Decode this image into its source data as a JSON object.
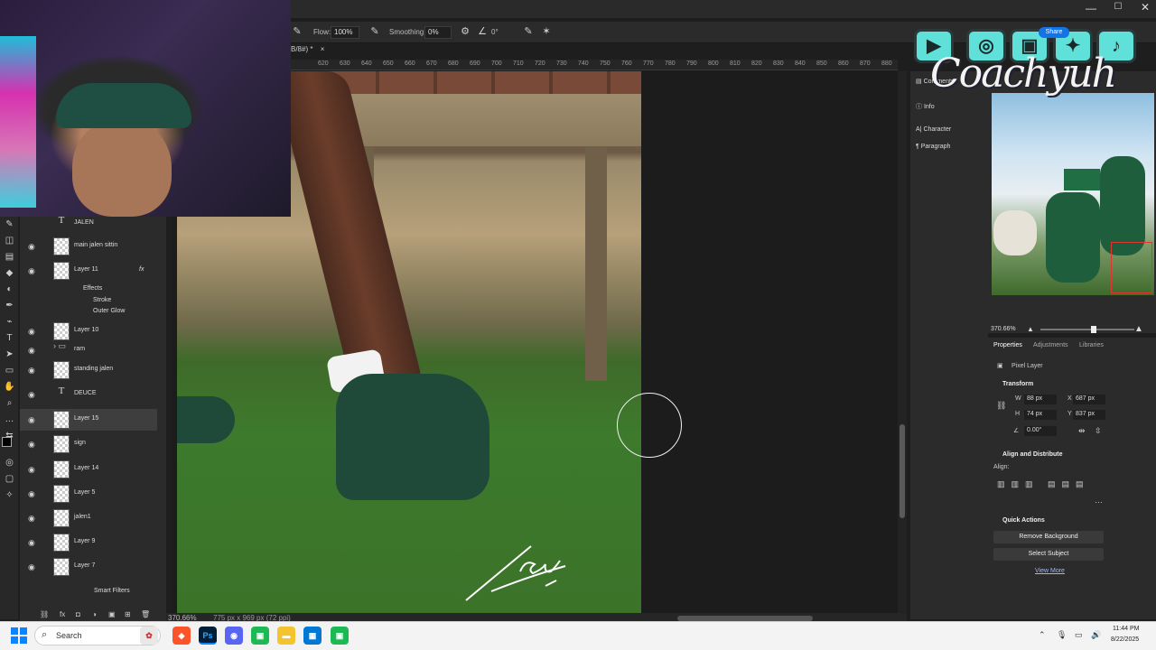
{
  "window": {
    "min_glyph": "—",
    "max_glyph": "☐",
    "close_glyph": "✕"
  },
  "options_bar": {
    "flow_label": "Flow:",
    "flow_value": "100%",
    "smoothing_label": "Smoothing:",
    "smoothing_value": "0%",
    "angle_value": "0°"
  },
  "document": {
    "tab_title": "B/8#) *",
    "tab_close": "×",
    "zoom": "370.66%",
    "doc_info": "775 px x 969 px (72 ppi)"
  },
  "ruler": {
    "ticks": [
      "620",
      "630",
      "640",
      "650",
      "660",
      "670",
      "680",
      "690",
      "700",
      "710",
      "720",
      "730",
      "740",
      "750",
      "760",
      "770",
      "780",
      "790",
      "800",
      "810",
      "820",
      "830",
      "840",
      "850",
      "860",
      "870",
      "880"
    ]
  },
  "layers": [
    {
      "name": "JALEN",
      "kind": "text"
    },
    {
      "name": "main jalen sittin",
      "kind": "pixel"
    },
    {
      "name": "Layer 11",
      "kind": "pixel",
      "fx": "fx"
    },
    {
      "name": "Layer 10",
      "kind": "pixel"
    },
    {
      "name": "ram",
      "kind": "group"
    },
    {
      "name": "standing jalen",
      "kind": "pixel"
    },
    {
      "name": "DEUCE",
      "kind": "text"
    },
    {
      "name": "Layer 15",
      "kind": "pixel",
      "selected": true
    },
    {
      "name": "sign",
      "kind": "pixel"
    },
    {
      "name": "Layer 14",
      "kind": "pixel"
    },
    {
      "name": "Layer 5",
      "kind": "pixel"
    },
    {
      "name": "jalen1",
      "kind": "pixel"
    },
    {
      "name": "Layer 9",
      "kind": "pixel"
    },
    {
      "name": "Layer 7",
      "kind": "pixel"
    }
  ],
  "effects": {
    "label": "Effects",
    "stroke": "Stroke",
    "outer_glow": "Outer Glow",
    "smart_filters": "Smart Filters"
  },
  "panel_strip": {
    "comments": "Comments",
    "info": "Info",
    "character": "Character",
    "paragraph": "Paragraph"
  },
  "navigator": {
    "zoom": "370.66%"
  },
  "properties": {
    "tabs": [
      "Properties",
      "Adjustments",
      "Libraries"
    ],
    "layer_type": "Pixel Layer",
    "transform_label": "Transform",
    "w_label": "W",
    "w_value": "88 px",
    "h_label": "H",
    "h_value": "74 px",
    "x_label": "X",
    "x_value": "687 px",
    "y_label": "Y",
    "y_value": "837 px",
    "angle_value": "0.00°",
    "align_label": "Align and Distribute",
    "align_sub": "Align:",
    "quick_actions": "Quick Actions",
    "remove_bg": "Remove Background",
    "select_subject": "Select Subject",
    "view_more": "View More"
  },
  "overlay": {
    "brand": "Coachyuh",
    "share": "Share"
  },
  "taskbar": {
    "search_placeholder": "Search",
    "time": "11:44 PM",
    "date": "8/22/2025"
  },
  "colors": {
    "selection_red": "#e0342e",
    "accent_blue": "#1473e6",
    "social_teal": "#5fe0d8"
  }
}
